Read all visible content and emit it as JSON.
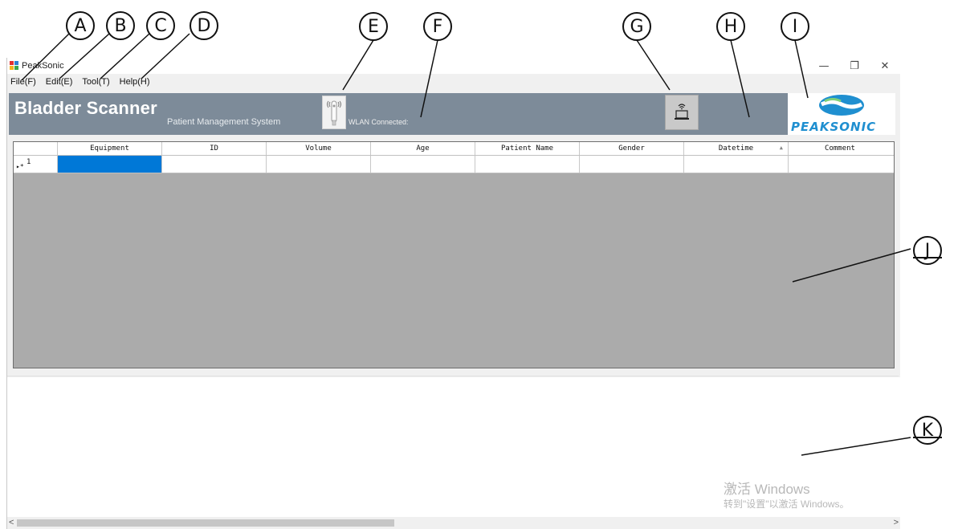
{
  "callouts": [
    "A",
    "B",
    "C",
    "D",
    "E",
    "F",
    "G",
    "H",
    "I",
    "J",
    "K"
  ],
  "window": {
    "title": "PeakSonic",
    "controls": {
      "minimize": "—",
      "maximize": "❐",
      "close": "✕"
    }
  },
  "menu": {
    "file": "File(F)",
    "edit": "Edit(E)",
    "tool": "Tool(T)",
    "help": "Help(H)"
  },
  "banner": {
    "title": "Bladder Scanner",
    "subtitle": "Patient Management System",
    "wlan_status": "WLAN Connected:",
    "logo_text": "PEAKSONIC",
    "background": "#7d8b99"
  },
  "grid": {
    "columns": [
      "Equipment",
      "ID",
      "Volume",
      "Age",
      "Patient Name",
      "Gender",
      "Datetime",
      "Comment"
    ],
    "sort_indicator": "▲",
    "rows": [
      {
        "marker": "▸*",
        "number": "1",
        "cells": [
          "",
          "",
          "",
          "",
          "",
          "",
          "",
          ""
        ]
      }
    ],
    "selection_color": "#0078d7"
  },
  "watermark": {
    "line1": "激活 Windows",
    "line2": "转到\"设置\"以激活 Windows。"
  },
  "scrollbar": {
    "left_arrow": "<",
    "right_arrow": ">"
  },
  "icons": [
    "app-icon",
    "probe-signal-icon",
    "wifi-laptop-icon",
    "peaksonic-logo"
  ]
}
